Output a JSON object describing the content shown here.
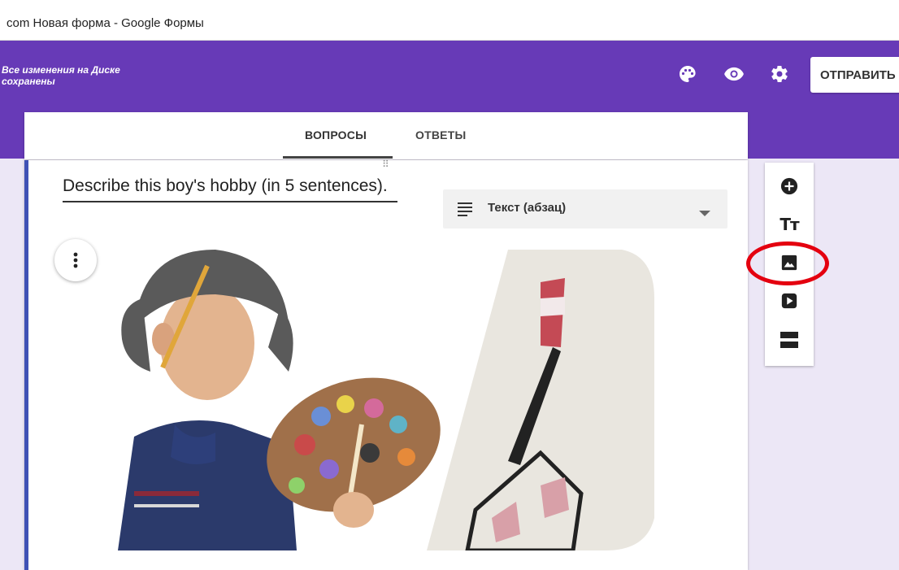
{
  "window": {
    "title": "com  Новая форма - Google Формы"
  },
  "header": {
    "save_status": "Все изменения на Диске сохранены",
    "send_label": "ОТПРАВИТЬ",
    "icons": [
      "palette-icon",
      "preview-eye-icon",
      "settings-gear-icon"
    ]
  },
  "tabs": [
    {
      "label": "ВОПРОСЫ",
      "active": true
    },
    {
      "label": "ОТВЕТЫ",
      "active": false
    }
  ],
  "question": {
    "title": "Describe this boy's hobby (in 5 sentences).",
    "type_label": "Текст (абзац)"
  },
  "sidebar": {
    "items": [
      "add-question-icon",
      "add-title-icon",
      "add-image-icon",
      "add-video-icon",
      "add-section-icon"
    ],
    "title_glyph": "Тт"
  },
  "colors": {
    "header": "#673ab7",
    "accent_border": "#3f51b5",
    "highlight": "#e4000f",
    "background": "#ece7f6"
  }
}
